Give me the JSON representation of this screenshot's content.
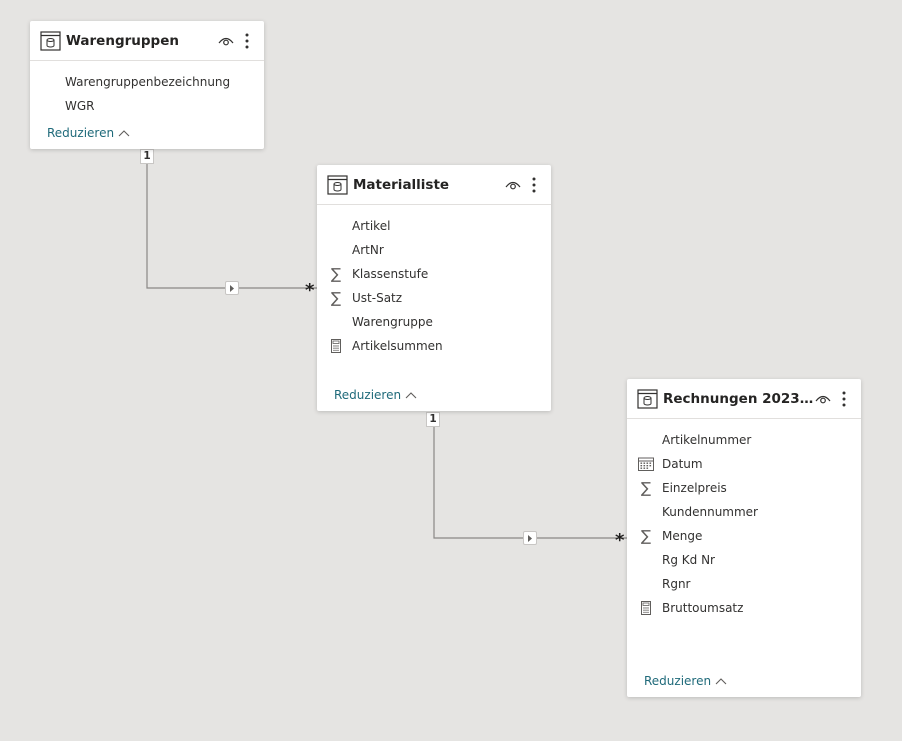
{
  "tables": {
    "warengruppen": {
      "title": "Warengruppen",
      "fields": [
        {
          "label": "Warengruppenbezeichnung",
          "icon": "none"
        },
        {
          "label": "WGR",
          "icon": "none"
        }
      ],
      "collapse_label": "Reduzieren"
    },
    "materialliste": {
      "title": "Materialliste",
      "fields": [
        {
          "label": "Artikel",
          "icon": "none"
        },
        {
          "label": "ArtNr",
          "icon": "none"
        },
        {
          "label": "Klassenstufe",
          "icon": "sigma-icon"
        },
        {
          "label": "Ust-Satz",
          "icon": "sigma-icon"
        },
        {
          "label": "Warengruppe",
          "icon": "none"
        },
        {
          "label": "Artikelsummen",
          "icon": "calculator-icon"
        }
      ],
      "collapse_label": "Reduzieren"
    },
    "rechnungen": {
      "title": "Rechnungen 2023_20...",
      "fields": [
        {
          "label": "Artikelnummer",
          "icon": "none"
        },
        {
          "label": "Datum",
          "icon": "calendar-icon"
        },
        {
          "label": "Einzelpreis",
          "icon": "sigma-icon"
        },
        {
          "label": "Kundennummer",
          "icon": "none"
        },
        {
          "label": "Menge",
          "icon": "sigma-icon"
        },
        {
          "label": "Rg Kd Nr",
          "icon": "none"
        },
        {
          "label": "Rgnr",
          "icon": "none"
        },
        {
          "label": "Bruttoumsatz",
          "icon": "calculator-icon"
        }
      ],
      "collapse_label": "Reduzieren"
    }
  },
  "relationships": [
    {
      "from": "Warengruppen",
      "to": "Materialliste",
      "one_label": "1",
      "many_label": "*"
    },
    {
      "from": "Materialliste",
      "to": "Rechnungen 2023_20...",
      "one_label": "1",
      "many_label": "*"
    }
  ],
  "colors": {
    "canvas": "#e5e4e2",
    "card": "#ffffff",
    "collapse_link": "#1f6a7a",
    "relationship_line": "#8a8886"
  }
}
